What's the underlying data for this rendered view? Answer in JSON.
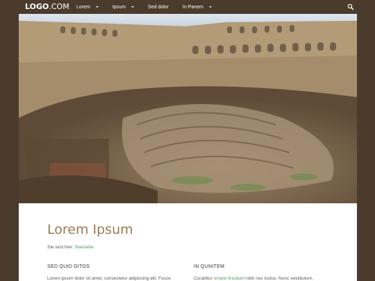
{
  "header": {
    "logo_bold": "LOGO",
    "logo_rest": ".COM",
    "nav": [
      {
        "label": "Lorem",
        "has_dropdown": true
      },
      {
        "label": "Ipsum",
        "has_dropdown": true
      },
      {
        "label": "Sed dolor",
        "has_dropdown": false
      },
      {
        "label": "In Panem",
        "has_dropdown": true
      }
    ],
    "search_icon": "search-icon"
  },
  "hero": {
    "image": "colosseum-interior-photo"
  },
  "main": {
    "title": "Lorem Ipsum",
    "breadcrumb_prefix": "Sie sind hier:",
    "breadcrumb_link": "Startseite",
    "columns": [
      {
        "heading": "SED QUID DITOS",
        "text": "Lorem ipsum dolor sit amet, consectetur adipiscing elit. Fusce"
      },
      {
        "heading": "IN QUNITEM",
        "text_before": "Curabitur",
        "text_link": "ornare tincidunt",
        "text_after": "nibh nec luctus. Nunc vestibulum,"
      }
    ]
  },
  "colors": {
    "brand_brown": "#4a3b2c",
    "title": "#9b7a4f",
    "link": "#4a9a54"
  }
}
